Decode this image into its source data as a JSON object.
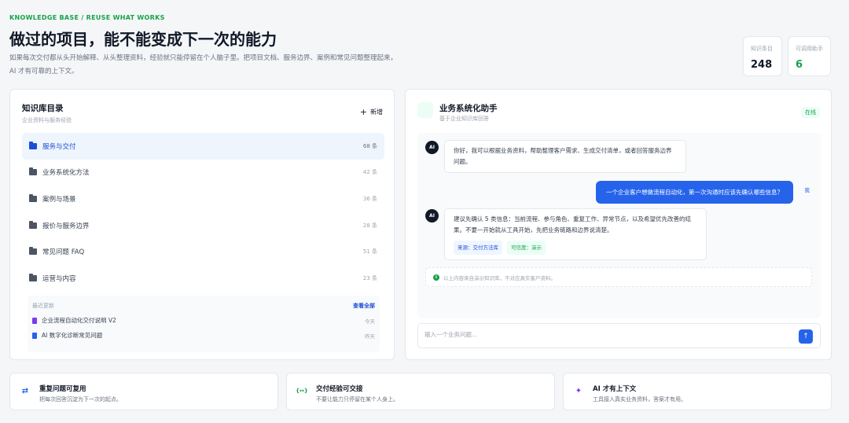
{
  "header": {
    "eyebrow": "KNOWLEDGE BASE / REUSE WHAT WORKS",
    "title": "做过的项目，能不能变成下一次的能力",
    "desc_line1": "如果每次交付都从头开始解释、从头整理资料，经验就只能停留在个人脑子里。把项目文档、服务边界、案例和常见问题整理起来，",
    "desc_line2": "AI 才有可靠的上下文。"
  },
  "stats": [
    {
      "label": "知识条目",
      "value": "248"
    },
    {
      "label": "可调用助手",
      "value": "6"
    }
  ],
  "catalog": {
    "title": "知识库目录",
    "subtitle": "企业资料与服务经验",
    "new_label": "新增",
    "items": [
      {
        "label": "服务与交付",
        "count": "68 条"
      },
      {
        "label": "业务系统化方法",
        "count": "42 条"
      },
      {
        "label": "案例与场景",
        "count": "36 条"
      },
      {
        "label": "报价与服务边界",
        "count": "28 条"
      },
      {
        "label": "常见问题 FAQ",
        "count": "51 条"
      },
      {
        "label": "运营与内容",
        "count": "23 条"
      }
    ],
    "recent": {
      "title": "最近更新",
      "view_all": "查看全部",
      "items": [
        {
          "title": "企业流程自动化交付说明 V2",
          "date": "今天",
          "color": "#7c3aed"
        },
        {
          "title": "AI 数字化诊断常见问题",
          "date": "昨天",
          "color": "#2563eb"
        }
      ]
    }
  },
  "assistant": {
    "title": "业务系统化助手",
    "subtitle": "基于企业知识库回答",
    "status": "在线",
    "ai_label": "AI",
    "me_label": "我",
    "msg1": "你好，我可以根据业务资料，帮助整理客户需求、生成交付清单，或者回答服务边界问题。",
    "user_msg": "一个企业客户想做流程自动化，第一次沟通时应该先确认哪些信息？",
    "msg2": "建议先确认 5 类信息：当前流程、参与角色、重复工作、异常节点，以及希望优先改善的结果。不要一开始就从工具开始，先把业务链路和边界说清楚。",
    "tag1": "来源：交付方法库",
    "tag2": "可信度：演示",
    "notice": "以上内容来自演示知识库，不对应真实客户资料。",
    "input_placeholder": "输入一个业务问题...",
    "send_icon": "↑"
  },
  "features": [
    {
      "title": "重复问题可复用",
      "desc": "把每次回答沉淀为下一次的起点。",
      "icon": "refresh-icon",
      "icon_glyph": "⇄",
      "color": "#2563eb"
    },
    {
      "title": "交付经验可交接",
      "desc": "不要让能力只停留在某个人身上。",
      "icon": "handoff-icon",
      "icon_glyph": "{↔}",
      "color": "#16a34a"
    },
    {
      "title": "AI 才有上下文",
      "desc": "工具接入真实业务资料，答案才有用。",
      "icon": "magic-wand-icon",
      "icon_glyph": "✦",
      "color": "#7c3aed"
    }
  ]
}
